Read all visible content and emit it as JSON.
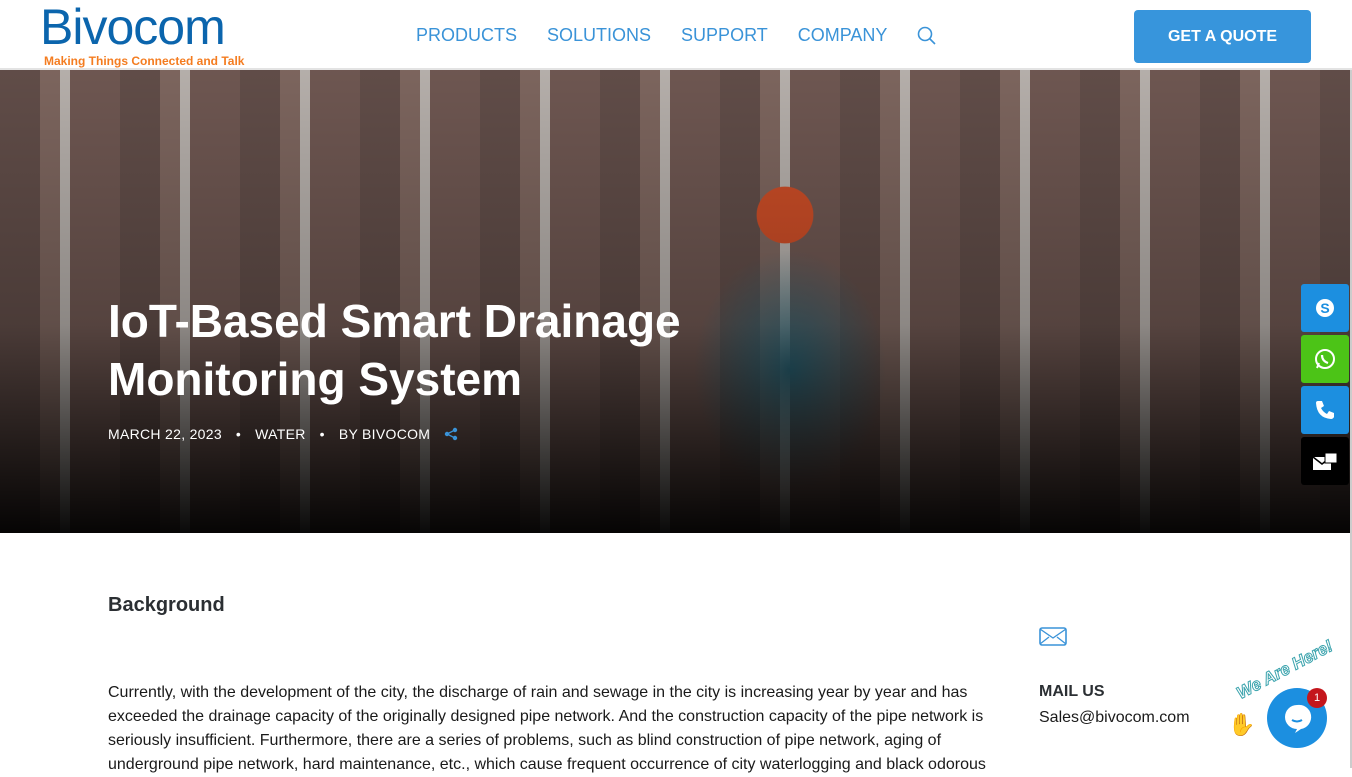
{
  "header": {
    "logo_name": "Bivocom",
    "logo_tagline": "Making Things Connected and Talk",
    "nav": [
      "PRODUCTS",
      "SOLUTIONS",
      "SUPPORT",
      "COMPANY"
    ],
    "quote_button": "GET A QUOTE"
  },
  "hero": {
    "title": "IoT-Based Smart Drainage Monitoring System",
    "date": "MARCH 22, 2023",
    "category": "WATER",
    "author": "BY BIVOCOM",
    "separator": "•"
  },
  "article": {
    "heading": "Background",
    "paragraph": "Currently, with the development of the city, the discharge of rain and sewage in the city is increasing year by year and has exceeded the drainage capacity of the originally designed pipe network. And the construction capacity of the pipe network is seriously insufficient. Furthermore, there are a series of problems, such as blind construction of pipe network, aging of underground pipe network, hard maintenance, etc., which cause frequent occurrence of city waterlogging and black odorous"
  },
  "sidebar": {
    "mail_label": "MAIL US",
    "mail_value": "Sales@bivocom.com"
  },
  "chat": {
    "banner": "We Are Here!",
    "badge": "1"
  },
  "colors": {
    "brand": "#0b65ad",
    "accent": "#3795dc",
    "tagline": "#f47c20",
    "skype": "#1c8fe0",
    "whatsapp": "#4cc417",
    "phone": "#1c8fe0",
    "mail": "#000000"
  }
}
